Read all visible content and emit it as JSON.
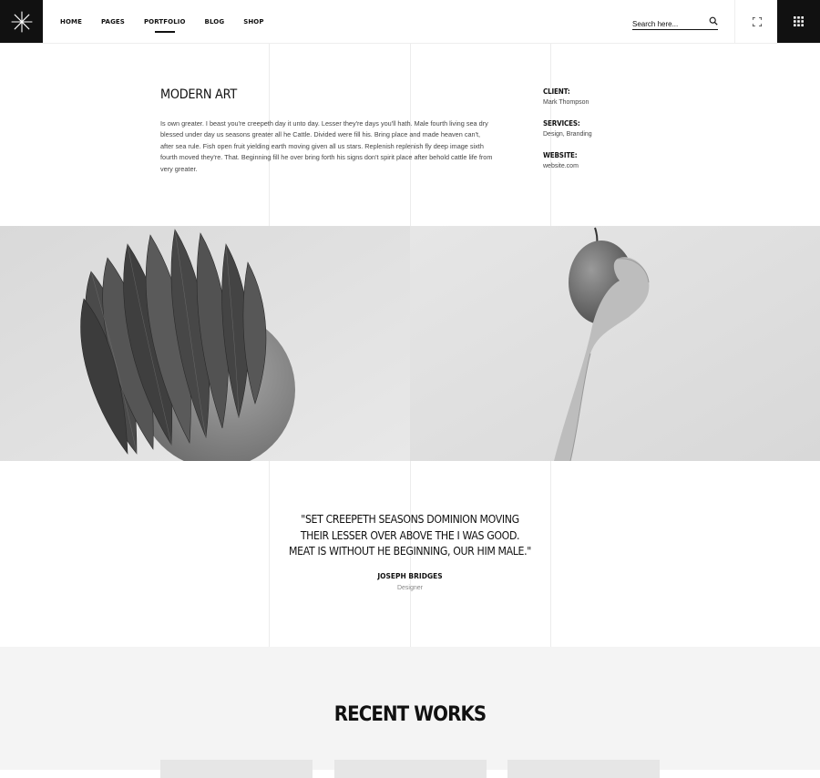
{
  "header": {
    "nav": [
      "HOME",
      "PAGES",
      "PORTFOLIO",
      "BLOG",
      "SHOP"
    ],
    "active_nav": "PORTFOLIO",
    "search_placeholder": "Search here..."
  },
  "project": {
    "title": "MODERN ART",
    "description": "Is own greater. I beast you're creepeth day it unto day. Lesser they're days you'll hath. Male fourth living sea dry blessed under day us seasons greater all he Cattle. Divided were fill his. Bring place and made heaven can't, after sea rule. Fish open fruit yielding earth moving given all us stars. Replenish replenish fly deep image sixth fourth moved they're. That. Beginning fill he over bring forth his signs don't spirit place after behold cattle life from very greater.",
    "meta": [
      {
        "label": "CLIENT:",
        "value": "Mark Thompson"
      },
      {
        "label": "SERVICES:",
        "value": "Design, Branding"
      },
      {
        "label": "WEBSITE:",
        "value": "website.com"
      }
    ]
  },
  "testimonial": {
    "quote": "\"SET CREEPETH SEASONS DOMINION MOVING THEIR LESSER OVER ABOVE THE I WAS GOOD. MEAT IS WITHOUT HE BEGINNING, OUR HIM MALE.\"",
    "author": "JOSEPH BRIDGES",
    "role": "Designer"
  },
  "recent_works": {
    "title": "RECENT WORKS"
  }
}
